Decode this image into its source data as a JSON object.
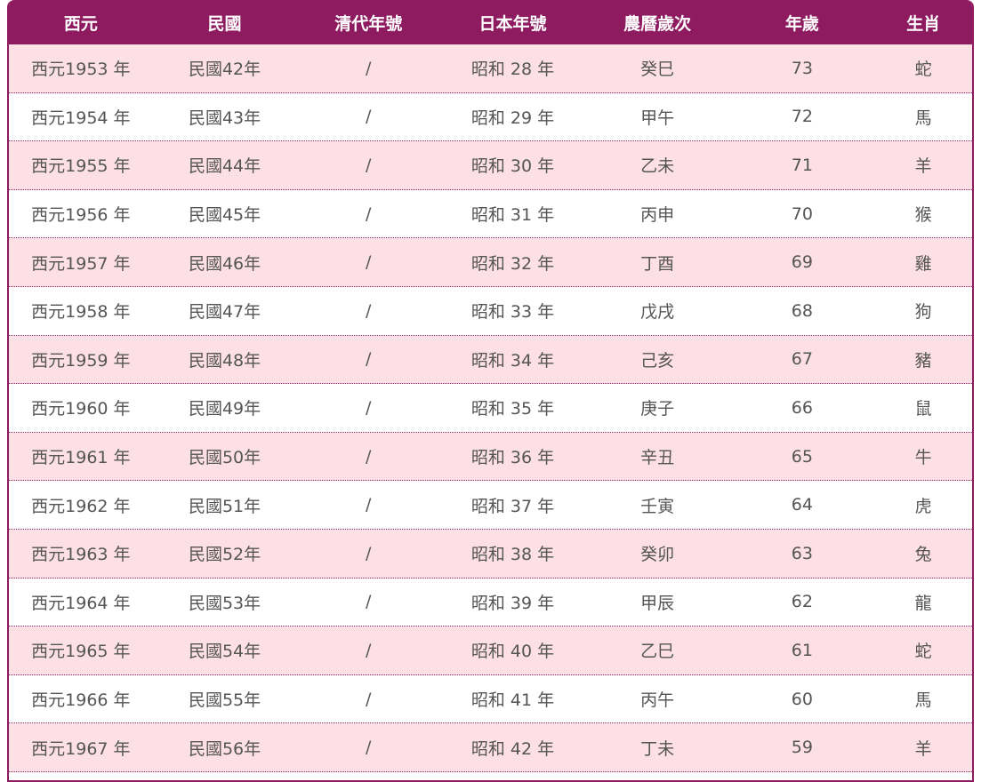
{
  "table": {
    "headers": [
      "西元",
      "民國",
      "清代年號",
      "日本年號",
      "農曆歲次",
      "年歲",
      "生肖"
    ],
    "rows": [
      [
        "西元1953 年",
        "民國42年",
        "/",
        "昭和 28 年",
        "癸巳",
        "73",
        "蛇"
      ],
      [
        "西元1954 年",
        "民國43年",
        "/",
        "昭和 29 年",
        "甲午",
        "72",
        "馬"
      ],
      [
        "西元1955 年",
        "民國44年",
        "/",
        "昭和 30 年",
        "乙未",
        "71",
        "羊"
      ],
      [
        "西元1956 年",
        "民國45年",
        "/",
        "昭和 31 年",
        "丙申",
        "70",
        "猴"
      ],
      [
        "西元1957 年",
        "民國46年",
        "/",
        "昭和 32 年",
        "丁酉",
        "69",
        "雞"
      ],
      [
        "西元1958 年",
        "民國47年",
        "/",
        "昭和 33 年",
        "戊戌",
        "68",
        "狗"
      ],
      [
        "西元1959 年",
        "民國48年",
        "/",
        "昭和 34 年",
        "己亥",
        "67",
        "豬"
      ],
      [
        "西元1960 年",
        "民國49年",
        "/",
        "昭和 35 年",
        "庚子",
        "66",
        "鼠"
      ],
      [
        "西元1961 年",
        "民國50年",
        "/",
        "昭和 36 年",
        "辛丑",
        "65",
        "牛"
      ],
      [
        "西元1962 年",
        "民國51年",
        "/",
        "昭和 37 年",
        "壬寅",
        "64",
        "虎"
      ],
      [
        "西元1963 年",
        "民國52年",
        "/",
        "昭和 38 年",
        "癸卯",
        "63",
        "兔"
      ],
      [
        "西元1964 年",
        "民國53年",
        "/",
        "昭和 39 年",
        "甲辰",
        "62",
        "龍"
      ],
      [
        "西元1965 年",
        "民國54年",
        "/",
        "昭和 40 年",
        "乙巳",
        "61",
        "蛇"
      ],
      [
        "西元1966 年",
        "民國55年",
        "/",
        "昭和 41 年",
        "丙午",
        "60",
        "馬"
      ],
      [
        "西元1967 年",
        "民國56年",
        "/",
        "昭和 42 年",
        "丁未",
        "59",
        "羊"
      ]
    ]
  },
  "colors": {
    "header_bg": "#8e1a5f",
    "row_pink": "#fde0e6",
    "row_white": "#ffffff",
    "text": "#555555"
  }
}
